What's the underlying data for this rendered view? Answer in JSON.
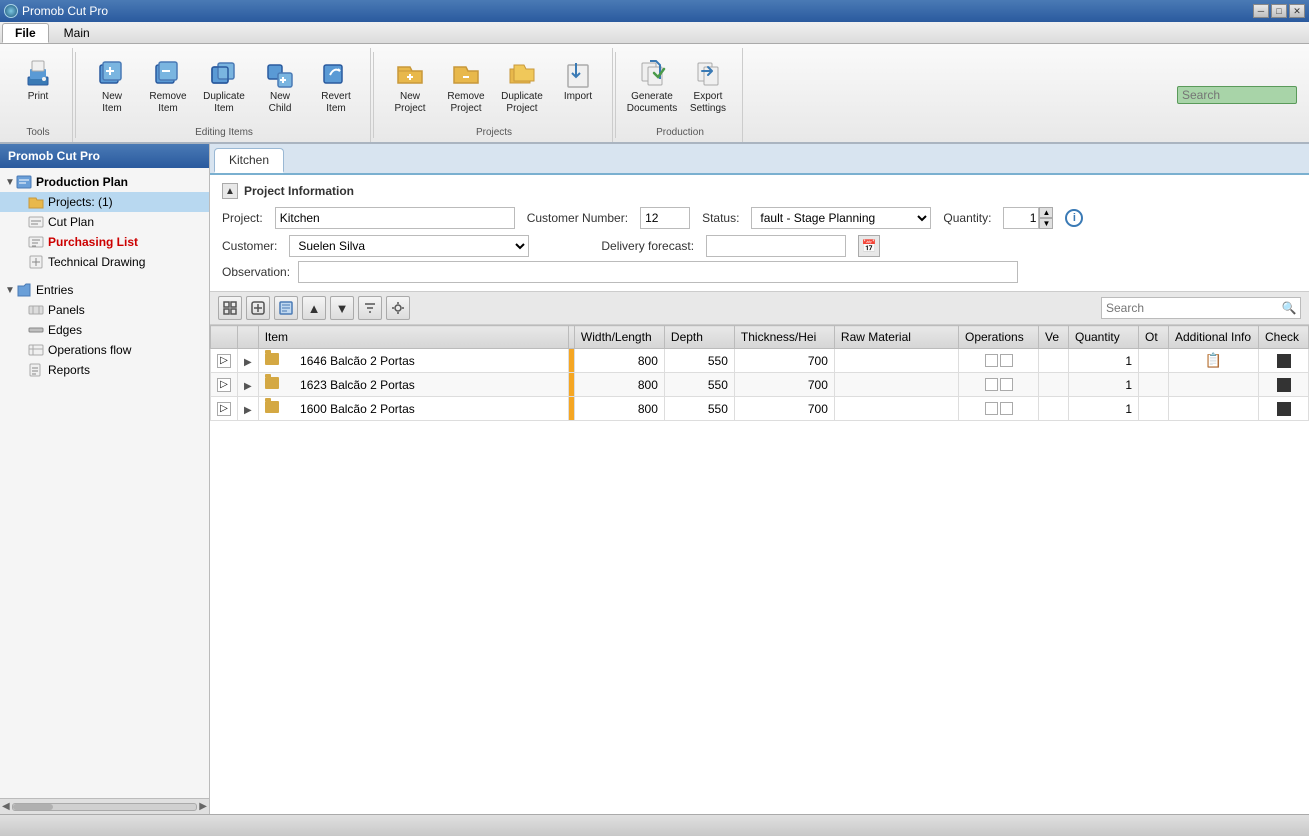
{
  "titlebar": {
    "title": "Promob Cut Pro",
    "min_btn": "─",
    "max_btn": "□",
    "close_btn": "✕"
  },
  "menu": {
    "tabs": [
      {
        "id": "file",
        "label": "File",
        "active": true
      },
      {
        "id": "main",
        "label": "Main",
        "active": false
      }
    ]
  },
  "ribbon": {
    "groups": [
      {
        "id": "tools",
        "label": "Tools",
        "buttons": [
          {
            "id": "print",
            "label": "Print",
            "icon": "🖨"
          }
        ]
      },
      {
        "id": "editing-items",
        "label": "Editing Items",
        "buttons": [
          {
            "id": "new-item",
            "label": "New\nItem",
            "icon": "📦"
          },
          {
            "id": "remove-item",
            "label": "Remove\nItem",
            "icon": "🗑"
          },
          {
            "id": "duplicate-item",
            "label": "Duplicate\nItem",
            "icon": "📋"
          },
          {
            "id": "new-child",
            "label": "New\nChild",
            "icon": "📦"
          },
          {
            "id": "revert-item",
            "label": "Revert\nItem",
            "icon": "↩"
          }
        ]
      },
      {
        "id": "projects",
        "label": "Projects",
        "buttons": [
          {
            "id": "new-project",
            "label": "New\nProject",
            "icon": "📁"
          },
          {
            "id": "remove-project",
            "label": "Remove\nProject",
            "icon": "🗑"
          },
          {
            "id": "duplicate-project",
            "label": "Duplicate\nProject",
            "icon": "📋"
          },
          {
            "id": "import",
            "label": "Import",
            "icon": "📥"
          }
        ]
      },
      {
        "id": "production",
        "label": "Production",
        "buttons": [
          {
            "id": "generate-documents",
            "label": "Generate\nDocuments",
            "icon": "📄"
          },
          {
            "id": "export-settings",
            "label": "Export\nSettings",
            "icon": "⚙"
          }
        ]
      }
    ],
    "search_placeholder": "Search"
  },
  "sidebar": {
    "title": "Promob Cut Pro",
    "tree": [
      {
        "id": "production-plan",
        "label": "Production Plan",
        "level": 0,
        "type": "group",
        "expanded": true,
        "bold": true
      },
      {
        "id": "projects",
        "label": "Projects: (1)",
        "level": 1,
        "type": "folder",
        "selected": true,
        "bold": false
      },
      {
        "id": "cut-plan",
        "label": "Cut Plan",
        "level": 1,
        "type": "list",
        "bold": false
      },
      {
        "id": "purchasing-list",
        "label": "Purchasing List",
        "level": 1,
        "type": "list",
        "bold": true,
        "red": true
      },
      {
        "id": "technical-drawing",
        "label": "Technical Drawing",
        "level": 1,
        "type": "doc",
        "bold": false
      },
      {
        "id": "entries",
        "label": "Entries",
        "level": 0,
        "type": "group",
        "expanded": true,
        "bold": false
      },
      {
        "id": "panels",
        "label": "Panels",
        "level": 1,
        "type": "list2",
        "bold": false
      },
      {
        "id": "edges",
        "label": "Edges",
        "level": 1,
        "type": "list2",
        "bold": false
      },
      {
        "id": "operations-flow",
        "label": "Operations flow",
        "level": 1,
        "type": "list2",
        "bold": false
      },
      {
        "id": "reports",
        "label": "Reports",
        "level": 1,
        "type": "doc2",
        "bold": false
      }
    ]
  },
  "content": {
    "tabs": [
      {
        "id": "kitchen",
        "label": "Kitchen",
        "active": true
      }
    ],
    "project_info": {
      "title": "Project Information",
      "project_label": "Project:",
      "project_value": "Kitchen",
      "customer_number_label": "Customer Number:",
      "customer_number_value": "12",
      "status_label": "Status:",
      "status_value": "fault - Stage Planning",
      "quantity_label": "Quantity:",
      "quantity_value": "1",
      "customer_label": "Customer:",
      "customer_value": "Suelen Silva",
      "delivery_label": "Delivery forecast:",
      "delivery_value": "",
      "observation_label": "Observation:",
      "observation_value": ""
    },
    "table": {
      "search_placeholder": "Search",
      "columns": [
        {
          "id": "expand",
          "label": ""
        },
        {
          "id": "arrow",
          "label": ""
        },
        {
          "id": "item",
          "label": "Item"
        },
        {
          "id": "orange",
          "label": ""
        },
        {
          "id": "width",
          "label": "Width/Length"
        },
        {
          "id": "depth",
          "label": "Depth"
        },
        {
          "id": "thickness",
          "label": "Thickness/Hei"
        },
        {
          "id": "rawmat",
          "label": "Raw Material"
        },
        {
          "id": "operations",
          "label": "Operations"
        },
        {
          "id": "ve",
          "label": "Ve"
        },
        {
          "id": "quantity",
          "label": "Quantity"
        },
        {
          "id": "ot",
          "label": "Ot"
        },
        {
          "id": "additional",
          "label": "Additional Info"
        },
        {
          "id": "check",
          "label": "Check"
        }
      ],
      "rows": [
        {
          "id": 1,
          "item": "1646 Balcão 2 Portas",
          "width": "800",
          "depth": "550",
          "thickness": "700",
          "rawmat": "",
          "operations": "",
          "ve": "",
          "quantity": "1",
          "ot": "",
          "additional": "doc",
          "check": "sq"
        },
        {
          "id": 2,
          "item": "1623 Balcão 2 Portas",
          "width": "800",
          "depth": "550",
          "thickness": "700",
          "rawmat": "",
          "operations": "",
          "ve": "",
          "quantity": "1",
          "ot": "",
          "additional": "",
          "check": "sq"
        },
        {
          "id": 3,
          "item": "1600 Balcão 2 Portas",
          "width": "800",
          "depth": "550",
          "thickness": "700",
          "rawmat": "",
          "operations": "",
          "ve": "",
          "quantity": "1",
          "ot": "",
          "additional": "",
          "check": "sq"
        }
      ]
    }
  }
}
